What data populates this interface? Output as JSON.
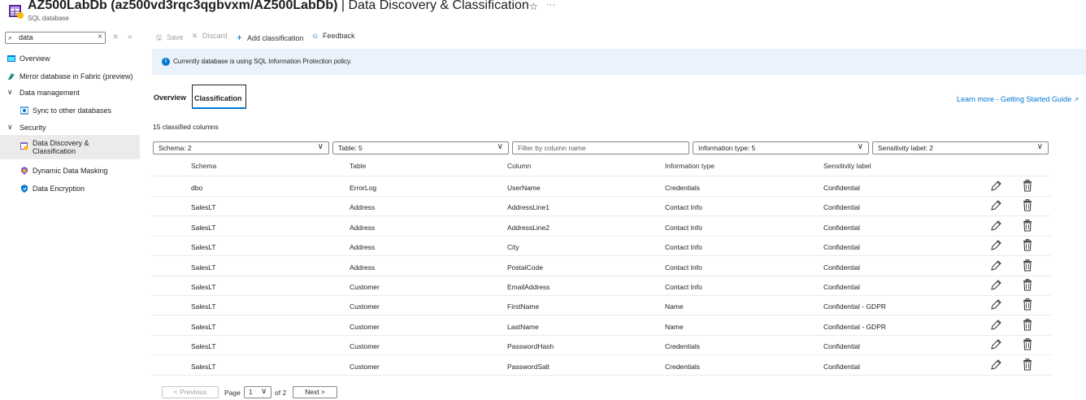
{
  "header": {
    "title_main": "AZ500LabDb (az500vd3rqc3qgbvxm/AZ500LabDb)",
    "title_sep": " | ",
    "title_page": "Data Discovery & Classification",
    "subtitle": "SQL database",
    "icon": "sql-database-icon",
    "star_icon": "☆",
    "more_icon": "···"
  },
  "sidebar": {
    "search_value": "data",
    "search_icon": "⌕",
    "clear_icon": "×",
    "items": [
      {
        "label": "Overview",
        "icon": "overview-icon"
      },
      {
        "label": "Mirror database in Fabric (preview)",
        "icon": "fabric-icon"
      },
      {
        "label": "Data management",
        "icon": "chevron-down-icon"
      },
      {
        "label": "Sync to other databases",
        "icon": "sync-icon"
      },
      {
        "label": "Security",
        "icon": "chevron-down-icon"
      },
      {
        "label": "Data Discovery &",
        "label2": "Classification",
        "icon": "data-discovery-icon"
      },
      {
        "label": "Dynamic Data Masking",
        "icon": "data-masking-icon"
      },
      {
        "label": "Data Encryption",
        "icon": "shield-icon"
      }
    ]
  },
  "toolbar": {
    "save": "Save",
    "discard": "Discard",
    "add": "Add classification",
    "feedback": "Feedback"
  },
  "banner": {
    "text": "Currently database is using SQL Information Protection policy."
  },
  "tabs": [
    {
      "label": "Overview",
      "active": false
    },
    {
      "label": "Classification",
      "active": true
    }
  ],
  "learn_more": "Learn more - Getting Started Guide",
  "count_text": "15 classified columns",
  "filters": {
    "schema": "Schema: 2",
    "table": "Table: 5",
    "column_placeholder": "Filter by column name",
    "info_type": "Information type: 5",
    "sensitivity": "Sensitivity label: 2"
  },
  "table": {
    "columns": [
      "Schema",
      "Table",
      "Column",
      "Information type",
      "Sensitivity label"
    ],
    "rows": [
      [
        "dbo",
        "ErrorLog",
        "UserName",
        "Credentials",
        "Confidential"
      ],
      [
        "SalesLT",
        "Address",
        "AddressLine1",
        "Contact Info",
        "Confidential"
      ],
      [
        "SalesLT",
        "Address",
        "AddressLine2",
        "Contact Info",
        "Confidential"
      ],
      [
        "SalesLT",
        "Address",
        "City",
        "Contact Info",
        "Confidential"
      ],
      [
        "SalesLT",
        "Address",
        "PostalCode",
        "Contact Info",
        "Confidential"
      ],
      [
        "SalesLT",
        "Customer",
        "EmailAddress",
        "Contact Info",
        "Confidential"
      ],
      [
        "SalesLT",
        "Customer",
        "FirstName",
        "Name",
        "Confidential - GDPR"
      ],
      [
        "SalesLT",
        "Customer",
        "LastName",
        "Name",
        "Confidential - GDPR"
      ],
      [
        "SalesLT",
        "Customer",
        "PasswordHash",
        "Credentials",
        "Confidential"
      ],
      [
        "SalesLT",
        "Customer",
        "PasswordSalt",
        "Credentials",
        "Confidential"
      ]
    ]
  },
  "pager": {
    "previous": "< Previous",
    "page_label": "Page",
    "page_value": "1",
    "of_label": "of 2",
    "next": "Next >"
  },
  "colors": {
    "accent": "#0078d4",
    "banner_bg": "#eaf3fb",
    "selected_bg": "#edebe9"
  }
}
